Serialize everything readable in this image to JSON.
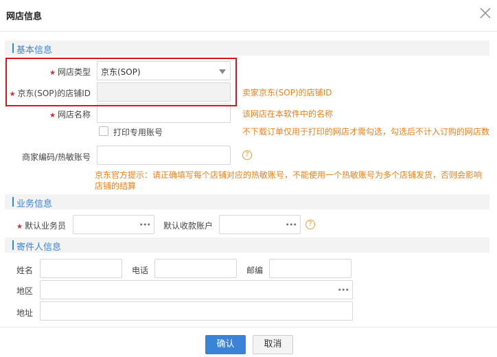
{
  "dialog": {
    "title": "网店信息"
  },
  "sections": {
    "basic": "基本信息",
    "business": "业务信息",
    "sender": "寄件人信息"
  },
  "basic": {
    "store_type_label": "网店类型",
    "store_type_value": "京东(SOP)",
    "store_id_label": "京东(SOP)的店铺ID",
    "store_id_hint": "卖家京东(SOP)的店铺ID",
    "store_name_label": "网店名称",
    "store_name_hint": "该网店在本软件中的名称",
    "print_only_label": "打印专用账号",
    "print_only_hint": "不下载订单仅用于打印的网店才需勾选，勾选后不计入订购的网店数",
    "merchant_code_label": "商家编码/热敏账号",
    "merchant_tip_line1": "京东官方提示：请正确填写每个店铺对应的热敏账号，不能使用一个热敏账号为多个店铺发货，否则会影响",
    "merchant_tip_line2": "店铺的结算"
  },
  "business": {
    "salesperson_label": "默认业务员",
    "account_label": "默认收款账户"
  },
  "sender": {
    "name_label": "姓名",
    "phone_label": "电话",
    "postcode_label": "邮编",
    "region_label": "地区",
    "address_label": "地址"
  },
  "symbols": {
    "required": "★",
    "help": "?",
    "more": "•••"
  },
  "footer": {
    "confirm": "确认",
    "cancel": "取消"
  },
  "colors": {
    "accent": "#3a83d6",
    "hint": "#f07f18",
    "required": "#d9262f",
    "highlight": "#d9151c"
  }
}
